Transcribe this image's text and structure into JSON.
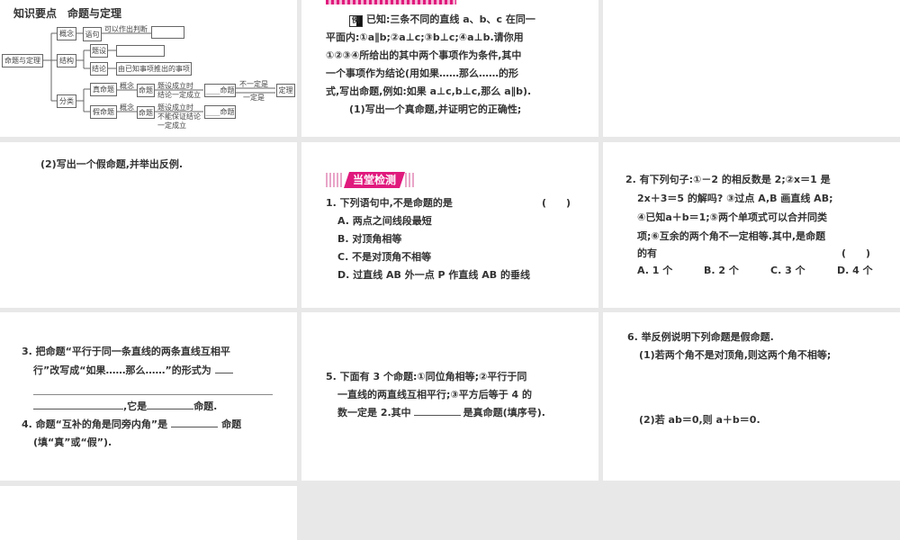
{
  "slide1": {
    "title": "知识要点　命题与定理",
    "root": "命题与定理",
    "concept": "概念",
    "statement": "语句",
    "judge": "可以作出判断",
    "structure": "结构",
    "hypothesis": "题设",
    "conclusion": "结论",
    "conclusion_desc": "由已知事项推出的事项",
    "classify": "分类",
    "true_prop": "真命题",
    "false_prop": "假命题",
    "concept2": "概念",
    "prop": "命题",
    "true_cond1": "题设成立时",
    "true_cond2": "结论一定成立",
    "false_cond1": "题设成立时",
    "false_cond2": "不能保证结论",
    "false_cond3": "一定成立",
    "blank_prop": "____命题",
    "not_necessarily": "不一定是",
    "necessarily": "一定是",
    "theorem": "定理"
  },
  "slide2": {
    "example_tag": "例",
    "lines": [
      "已知:三条不同的直线 a、b、c 在同一",
      "平面内:①a∥b;②a⊥c;③b⊥c;④a⊥b.请你用",
      "①②③④所给出的其中两个事项作为条件,其中",
      "一个事项作为结论(用如果……那么……的形",
      "式,写出命题,例如:如果 a⊥c,b⊥c,那么 a∥b).",
      "(1)写出一个真命题,并证明它的正确性;"
    ]
  },
  "slide4": {
    "text": "(2)写出一个假命题,并举出反例."
  },
  "slide5": {
    "banner": "当堂检测",
    "q1": "1. 下列语句中,不是命题的是",
    "paren": "(　　)",
    "options": [
      "A. 两点之间线段最短",
      "B. 对顶角相等",
      "C. 不是对顶角不相等",
      "D. 过直线 AB 外一点 P 作直线 AB 的垂线"
    ]
  },
  "slide6": {
    "lines": [
      "2. 有下列句子:①－2 的相反数是 2;②x＝1 是",
      "2x＋3＝5 的解吗? ③过点 A,B 画直线 AB;",
      "④已知a＋b＝1;⑤两个单项式可以合并同类",
      "项;⑥互余的两个角不一定相等.其中,是命题",
      "的有"
    ],
    "paren": "(　　)",
    "options": [
      "A. 1 个",
      "B. 2 个",
      "C. 3 个",
      "D. 4 个"
    ]
  },
  "slide7": {
    "q3_line1": "3. 把命题“平行于同一条直线的两条直线互相平",
    "q3_line2": "行”改写成“如果……那么……”的形式为",
    "q3_line3a": ",它是",
    "q3_line3b": "命题.",
    "q4_line1a": "4. 命题“互补的角是同旁内角”是",
    "q4_line1b": "命题",
    "q4_line2": "(填“真”或“假”)."
  },
  "slide8": {
    "line1": "5. 下面有 3 个命题:①同位角相等;②平行于同",
    "line2": "一直线的两直线互相平行;③平方后等于 4 的",
    "line3a": "数一定是 2.其中",
    "line3b": "是真命题(填序号)."
  },
  "slide9": {
    "title": "6. 举反例说明下列命题是假命题.",
    "part1": "(1)若两个角不是对顶角,则这两个角不相等;",
    "part2": "(2)若 ab＝0,则 a＋b＝0."
  }
}
